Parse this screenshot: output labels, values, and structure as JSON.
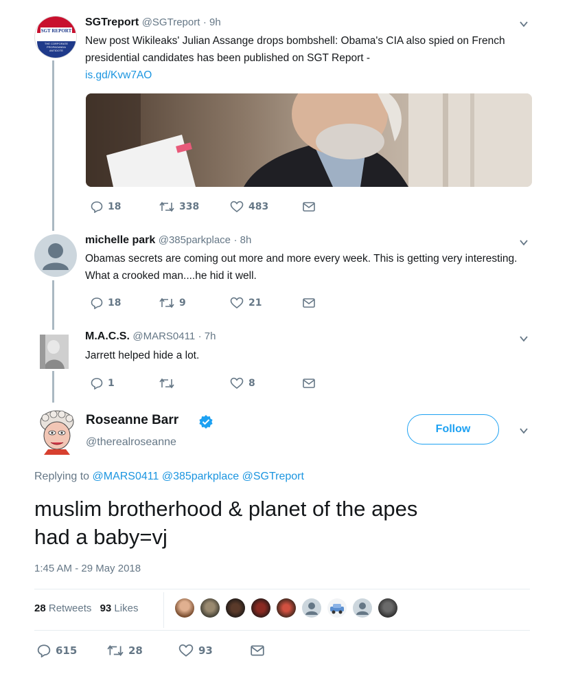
{
  "tweets": [
    {
      "name": "SGTreport",
      "handle": "@SGTreport",
      "time": "· 9h",
      "text": "New post Wikileaks' Julian Assange drops bombshell: Obama's CIA also spied on French presidential candidates has been published on SGT Report -",
      "link": "is.gd/Kvw7AO",
      "avatar_text": "SGT REPORT",
      "avatar_sub": "THE CORPORATE PROPAGANDA ANTIDOTE",
      "replies": "18",
      "retweets": "338",
      "likes": "483"
    },
    {
      "name": "michelle park",
      "handle": "@385parkplace",
      "time": "· 8h",
      "text": "Obamas secrets are coming out more and more every week. This is getting very interesting.  What a crooked man....he hid it well.",
      "replies": "18",
      "retweets": "9",
      "likes": "21"
    },
    {
      "name": "M.A.C.S.",
      "handle": "@MARS0411",
      "time": "· 7h",
      "text": "Jarrett helped hide a lot.",
      "replies": "1",
      "retweets": "",
      "likes": "8"
    }
  ],
  "main": {
    "name": "Roseanne Barr",
    "handle": "@therealroseanne",
    "follow_label": "Follow",
    "replying_prefix": "Replying to",
    "replying_to": "@MARS0411 @385parkplace @SGTreport",
    "text_line1": "muslim brotherhood & planet of the apes",
    "text_line2": "had a baby=vj",
    "timestamp": "1:45 AM - 29 May 2018",
    "retweets_count": "28",
    "retweets_label": "Retweets",
    "likes_count": "93",
    "likes_label": "Likes",
    "replies": "615",
    "retweets": "28",
    "likes": "93"
  },
  "colors": {
    "accent": "#1da1f2",
    "verified": "#1da1f2",
    "muted": "#657786",
    "thread": "#aab8c2"
  }
}
